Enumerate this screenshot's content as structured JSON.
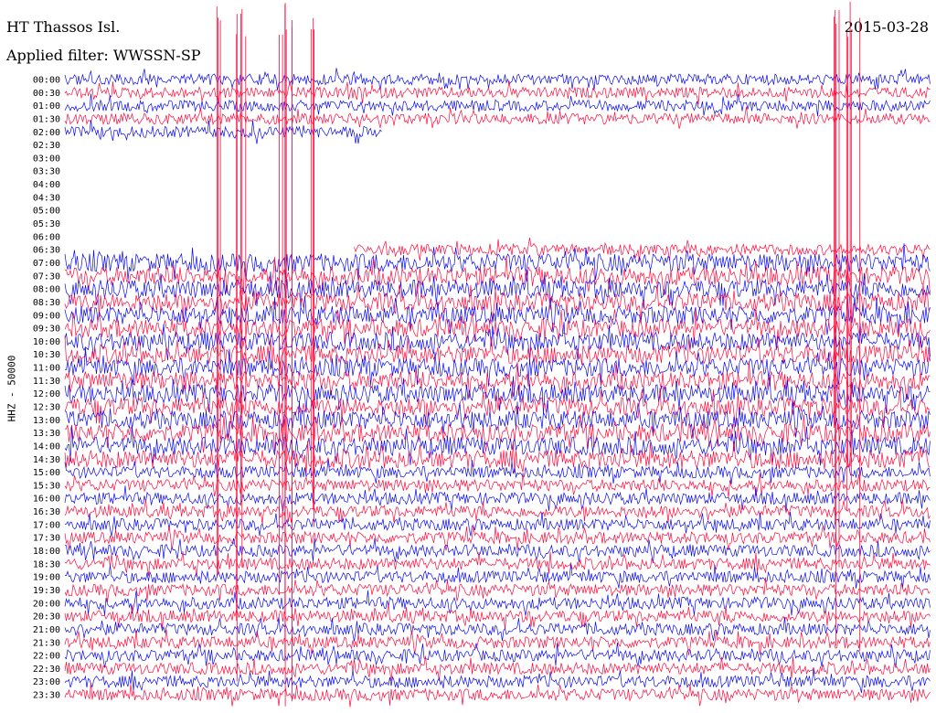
{
  "header": {
    "station": "HT Thassos Isl.",
    "filter_label": "Applied filter: WWSSN-SP",
    "date": "2015-03-28"
  },
  "colors": {
    "trace_a": "#0a0af0",
    "trace_b": "#ff0a3c"
  },
  "chart_data": {
    "type": "line",
    "title": "HT Thassos Isl.",
    "subtitle": "Applied filter: WWSSN-SP",
    "date": "2015-03-28",
    "ylabel": "HHZ - 50000",
    "rows": [
      "00:00",
      "00:30",
      "01:00",
      "01:30",
      "02:00",
      "02:30",
      "03:00",
      "03:30",
      "04:00",
      "04:30",
      "05:00",
      "05:30",
      "06:00",
      "06:30",
      "07:00",
      "07:30",
      "08:00",
      "08:30",
      "09:00",
      "09:30",
      "10:00",
      "10:30",
      "11:00",
      "11:30",
      "12:00",
      "12:30",
      "13:00",
      "13:30",
      "14:00",
      "14:30",
      "15:00",
      "15:30",
      "16:00",
      "16:30",
      "17:00",
      "17:30",
      "18:00",
      "18:30",
      "19:00",
      "19:30",
      "20:00",
      "20:30",
      "21:00",
      "21:30",
      "22:00",
      "22:30",
      "23:00",
      "23:30"
    ],
    "row_minutes": 30,
    "data_gap": {
      "start": "02:11",
      "end": "06:40"
    },
    "series": [
      {
        "color": "#0a0af0"
      },
      {
        "color": "#ff0a3c"
      }
    ]
  }
}
